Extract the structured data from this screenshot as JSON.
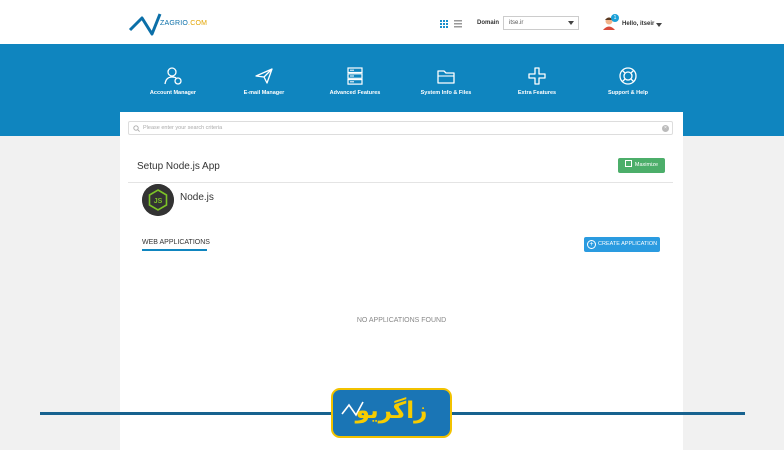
{
  "header": {
    "logo_name": "ZAGRIO",
    "logo_tld": ".COM",
    "domain_label": "Domain",
    "domain_value": "itse.ir",
    "user_badge": "1",
    "user_greeting": "Hello, itseir"
  },
  "nav": [
    {
      "label": "Account Manager",
      "icon": "user-gear-icon"
    },
    {
      "label": "E-mail Manager",
      "icon": "paper-plane-icon"
    },
    {
      "label": "Advanced Features",
      "icon": "server-icon"
    },
    {
      "label": "System Info & Files",
      "icon": "folder-icon"
    },
    {
      "label": "Extra Features",
      "icon": "plus-icon"
    },
    {
      "label": "Support & Help",
      "icon": "lifebuoy-icon"
    }
  ],
  "search": {
    "placeholder": "Please enter your search criteria"
  },
  "page": {
    "title": "Setup Node.js App",
    "maximize_label": "Maximize",
    "app_name": "Node.js",
    "tab_label": "WEB APPLICATIONS",
    "create_label": "CREATE APPLICATION",
    "empty_message": "NO APPLICATIONS FOUND"
  },
  "watermark": {
    "text": "زاگریو"
  },
  "colors": {
    "header_blue": "#0f85bf",
    "maximize_green": "#4cae6a",
    "create_blue": "#2a9be0",
    "brand_yellow": "#f7cc00"
  }
}
